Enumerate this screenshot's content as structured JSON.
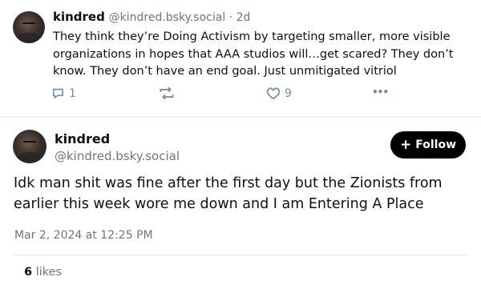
{
  "reply_post": {
    "author_name": "kindred",
    "handle_time": "@kindred.bsky.social · 2d",
    "text": "They think they’re Doing Activism by targeting smaller, more visible organizations in hopes that AAA studios will…get scared? They don’t know. They don’t have an end goal. Just unmitigated vitriol",
    "reply_count": "1",
    "like_count": "9",
    "more_label": "•••"
  },
  "main_post": {
    "author_name": "kindred",
    "handle": "@kindred.bsky.social",
    "follow_label": "Follow",
    "follow_icon": "+",
    "text": "Idk man shit was fine after the first day but the Zionists from earlier this week wore me down and I am Entering A Place",
    "timestamp": "Mar 2, 2024 at 12:25 PM",
    "likes_count": "6",
    "likes_label": "likes"
  },
  "colors": {
    "action_icon": "#6f8aa8",
    "muted_text": "#6a7685",
    "divider": "#e4e8ec",
    "follow_bg": "#000000"
  }
}
